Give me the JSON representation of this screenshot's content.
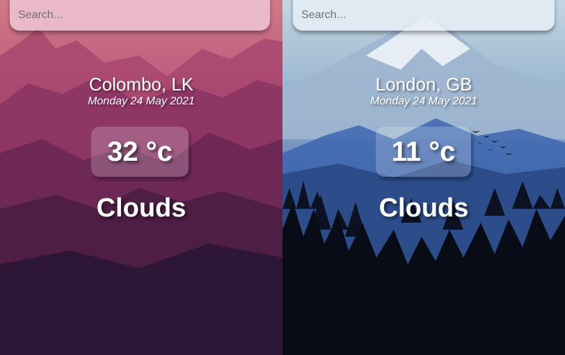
{
  "cards": [
    {
      "search_placeholder": "Search...",
      "location": "Colombo, LK",
      "date": "Monday 24 May 2021",
      "temperature": "32 °c",
      "weather": "Clouds",
      "theme": "warm-pink-mountains"
    },
    {
      "search_placeholder": "Search...",
      "location": "London, GB",
      "date": "Monday 24 May 2021",
      "temperature": "11 °c",
      "weather": "Clouds",
      "theme": "cold-blue-mountains-forest"
    }
  ],
  "colors": {
    "warm_top": "#c8707f",
    "warm_bottom": "#1e1530",
    "cold_top": "#b9cfdc",
    "cold_bottom": "#0b0f1c",
    "text": "#ffffff"
  }
}
